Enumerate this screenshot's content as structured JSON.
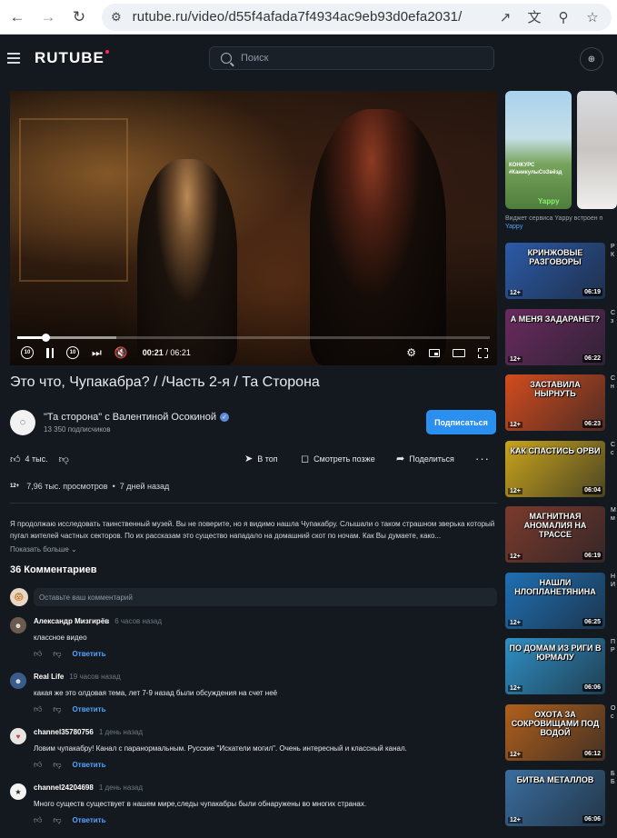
{
  "browser": {
    "url": "rutube.ru/video/d55f4afada7f4934ac9eb93d0efa2031/"
  },
  "header": {
    "logo": "RUTUBE",
    "search_placeholder": "Поиск"
  },
  "player": {
    "current_time": "00:21",
    "separator": " / ",
    "duration": "06:21",
    "progress_fraction": 0.06,
    "buffer_fraction": 0.21,
    "rewind_label": "10",
    "forward_label": "10"
  },
  "video": {
    "title": "Это что, Чупакабра? / /Часть 2-я / Та Сторона",
    "channel_name": "\"Та сторона\" с Валентиной Осокиной",
    "subscribers": "13 350 подписчиков",
    "subscribe_label": "Подписаться",
    "likes": "4 тыс.",
    "actions": {
      "top": "В топ",
      "watch_later": "Смотреть позже",
      "share": "Поделиться"
    },
    "age_rating": "12+",
    "views": "7,96 тыс. просмотров",
    "published": "7 дней назад",
    "description": "Я продолжаю исследовать таинственный музей. Вы не поверите, но я видимо нашла Чупакабру. Слышали о таком страшном зверька который пугал жителей частных секторов. По их рассказам это существо нападало на домашний скот по ночам. Как Вы думаете, како...",
    "show_more": "Показать больше"
  },
  "comments": {
    "title": "36 Комментариев",
    "input_placeholder": "Оставьте ваш комментарий",
    "reply_label": "Ответить",
    "items": [
      {
        "author": "Александр Мизгирёв",
        "time": "6 часов назад",
        "text": "классное видео",
        "avatar_color": "#6b5a4e"
      },
      {
        "author": "Real Life",
        "time": "19 часов назад",
        "text": "какая же это олдовая тема, лет 7-9 назад были обсуждения на счет неё",
        "avatar_color": "#3b5c8a"
      },
      {
        "author": "channel35780756",
        "time": "1 день назад",
        "text": "Ловим чупакабру! Канал с паранормальным. Русские \"Искатели могил\". Очень интересный и классный канал.",
        "avatar_color": "#e8e4e0"
      },
      {
        "author": "channel24204698",
        "time": "1 день назад",
        "text": "Много существ существует в нашем мире,следы чупакабры были обнаружены во многих странах.",
        "avatar_color": "#f4f4f4"
      }
    ]
  },
  "sidebar": {
    "shorts_caption": "КОНКУРС #КаникулыСоЗвёзд",
    "shorts_brand": "Yappy",
    "widget_text": "Виджет сервиса Yappy встроен п",
    "widget_source": "Yappy",
    "recommendations": [
      {
        "caption": "КРИНЖОВЫЕ РАЗГОВОРЫ",
        "badge": "12+",
        "duration": "06:19",
        "title": "Р К",
        "bg": "#2c5aa8"
      },
      {
        "caption": "А МЕНЯ ЗАДАРАНЕТ?",
        "badge": "12+",
        "duration": "06:22",
        "title": "С з",
        "bg": "#6a2a5e"
      },
      {
        "caption": "ЗАСТАВИЛА НЫРНУТЬ",
        "badge": "12+",
        "duration": "06:23",
        "title": "С н",
        "bg": "#d34c1e"
      },
      {
        "caption": "КАК СПАСТИСЬ ОРВИ",
        "badge": "12+",
        "duration": "06:04",
        "title": "С с",
        "bg": "#c9a41c"
      },
      {
        "caption": "МАГНИТНАЯ АНОМАЛИЯ НА ТРАССЕ",
        "badge": "12+",
        "duration": "06:19",
        "title": "М м",
        "bg": "#7b3a2c"
      },
      {
        "caption": "НАШЛИ НЛОПЛАНЕТЯНИНА",
        "badge": "12+",
        "duration": "06:25",
        "title": "Н И",
        "bg": "#1f6fb3"
      },
      {
        "caption": "ПО ДОМАМ ИЗ РИГИ В ЮРМАЛУ",
        "badge": "12+",
        "duration": "06:06",
        "title": "П Р",
        "bg": "#2f8fc4"
      },
      {
        "caption": "ОХОТА ЗА СОКРОВИЩАМИ ПОД ВОДОЙ",
        "badge": "12+",
        "duration": "06:12",
        "title": "О с",
        "bg": "#b05f1c"
      },
      {
        "caption": "БИТВА МЕТАЛЛОВ",
        "badge": "12+",
        "duration": "06:06",
        "title": "Б Б",
        "bg": "#3a6e9e"
      }
    ]
  }
}
